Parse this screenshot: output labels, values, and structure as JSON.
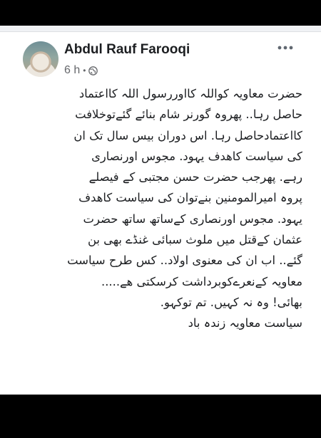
{
  "post": {
    "author": "Abdul Rauf Farooqi",
    "time": "6 h",
    "separator": "•",
    "privacy_icon": "globe-icon",
    "more_icon": "more-horizontal-icon",
    "lines": [
      "حضرت معاویہ کواللہ کااوررسول اللہ کااعتماد",
      "حاصل رہا.. پھروہ گورنر شام بنائے گئےتوخلافت",
      "کااعتمادحاصل رہا. اس دوران بیس سال تک ان",
      "کی سیاست کاھدف یہود. مجوس اورنصاری",
      "رہے. پھرجب حضرت حسن مجتبی کے فیصلے",
      "پروہ امیرالمومنین بنےتوان کی سیاست کاھدف",
      "یہود. مجوس اورنصاری کےساتھ ساتھ حضرت",
      "عثمان کےقتل میں ملوث سبائی غنڈے بھی بن",
      "گئے.. اب ان کی معنوی اولاد.. کس طرح سیاست",
      "معاویہ کےنعرےکوبرداشت کرسکتی ھے.....",
      "بھائی! وہ نہ کہیں. تم توکہو.",
      "سیاست معاویہ زندہ باد"
    ]
  }
}
